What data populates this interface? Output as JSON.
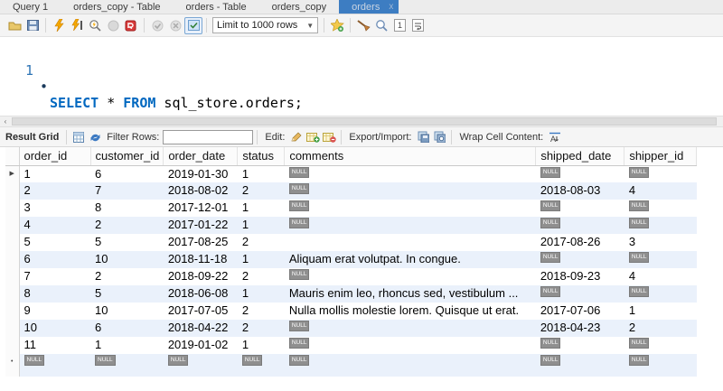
{
  "tabs": [
    {
      "label": "Query 1",
      "active": false
    },
    {
      "label": "orders_copy - Table",
      "active": false
    },
    {
      "label": "orders - Table",
      "active": false
    },
    {
      "label": "orders_copy",
      "active": false
    },
    {
      "label": "orders",
      "active": true,
      "close_glyph": "x"
    }
  ],
  "query_toolbar": {
    "limit_dropdown_value": "Limit to 1000 rows",
    "icons": [
      "open-script-icon",
      "save-script-icon",
      "execute-icon",
      "execute-current-icon",
      "explain-icon",
      "stop-icon",
      "stop-on-error-icon",
      "commit-icon",
      "rollback-icon",
      "autocommit-icon",
      "save-snippet-icon",
      "beautify-icon",
      "find-icon",
      "invisibles-icon",
      "wrap-text-icon"
    ]
  },
  "editor": {
    "line_number": "1",
    "bullet": "•",
    "tokens": [
      {
        "text": "SELECT",
        "type": "keyword"
      },
      {
        "text": " * ",
        "type": "plain"
      },
      {
        "text": "FROM",
        "type": "keyword"
      },
      {
        "text": " sql_store.orders;",
        "type": "plain"
      }
    ]
  },
  "hscroll": {
    "left_arrow": "‹"
  },
  "result_toolbar": {
    "title": "Result Grid",
    "filter_label": "Filter Rows:",
    "filter_value": "",
    "edit_label": "Edit:",
    "export_label": "Export/Import:",
    "wrap_label": "Wrap Cell Content:",
    "icons": [
      "grid-icon",
      "refresh-icon",
      "edit-pencil-icon",
      "add-row-icon",
      "delete-row-icon",
      "export-icon",
      "import-icon",
      "wrap-cell-icon"
    ]
  },
  "grid": {
    "null_text": "NULL",
    "row1_marker": "▶",
    "newrow_marker": "•",
    "columns": [
      "order_id",
      "customer_id",
      "order_date",
      "status",
      "comments",
      "shipped_date",
      "shipper_id"
    ],
    "rows": [
      [
        "1",
        "6",
        "2019-01-30",
        "1",
        null,
        null,
        null
      ],
      [
        "2",
        "7",
        "2018-08-02",
        "2",
        null,
        "2018-08-03",
        "4"
      ],
      [
        "3",
        "8",
        "2017-12-01",
        "1",
        null,
        null,
        null
      ],
      [
        "4",
        "2",
        "2017-01-22",
        "1",
        null,
        null,
        null
      ],
      [
        "5",
        "5",
        "2017-08-25",
        "2",
        "",
        "2017-08-26",
        "3"
      ],
      [
        "6",
        "10",
        "2018-11-18",
        "1",
        "Aliquam erat volutpat. In congue.",
        null,
        null
      ],
      [
        "7",
        "2",
        "2018-09-22",
        "2",
        null,
        "2018-09-23",
        "4"
      ],
      [
        "8",
        "5",
        "2018-06-08",
        "1",
        "Mauris enim leo, rhoncus sed, vestibulum ...",
        null,
        null
      ],
      [
        "9",
        "10",
        "2017-07-05",
        "2",
        "Nulla mollis molestie lorem. Quisque ut erat.",
        "2017-07-06",
        "1"
      ],
      [
        "10",
        "6",
        "2018-04-22",
        "2",
        null,
        "2018-04-23",
        "2"
      ],
      [
        "11",
        "1",
        "2019-01-02",
        "1",
        null,
        null,
        null
      ]
    ],
    "new_row": [
      null,
      null,
      null,
      null,
      null,
      null,
      null
    ]
  },
  "colors": {
    "active_tab_bg": "#3d7dc2",
    "alt_row_bg": "#eaf1fb",
    "keyword_blue": "#0068c0",
    "null_badge_bg": "#8f8f8f",
    "exec_bolt_yellow": "#f5a800"
  }
}
